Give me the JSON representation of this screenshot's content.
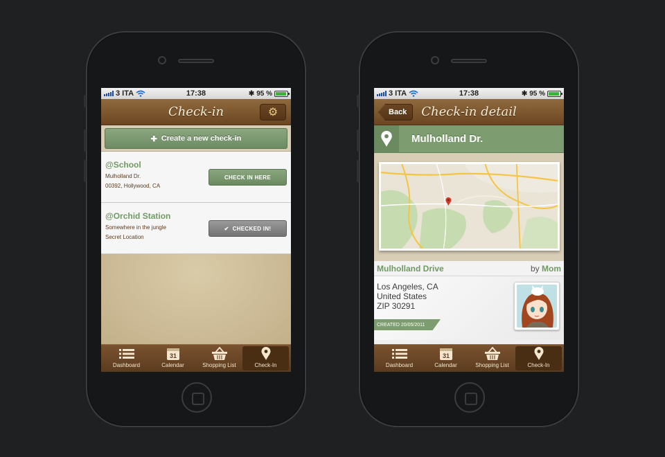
{
  "status": {
    "carrier": "3 ITA",
    "time": "17:38",
    "battery": "95 %",
    "battery_level": 0.95
  },
  "left_screen": {
    "title": "Check-in",
    "create_button": "Create a new check-in",
    "items": [
      {
        "name": "@School",
        "line1": "Mulholland Dr.",
        "line2": "00392, Hollywood, CA",
        "button": "CHECK IN HERE",
        "state": "check-in"
      },
      {
        "name": "@Orchid Station",
        "line1": "Somewhere in the jungle",
        "line2": "Secret Location",
        "button": "CHECKED IN!",
        "state": "checked"
      }
    ]
  },
  "right_screen": {
    "title": "Check-in detail",
    "back_label": "Back",
    "location_name": "Mulholland Dr.",
    "street": "Mulholland Drive",
    "by_label": "by",
    "author": "Mom",
    "address": [
      "Los Angeles, CA",
      "United States",
      "ZIP 30291"
    ],
    "created": "CREATED 20/05/2011"
  },
  "tabs": [
    {
      "label": "Dashboard",
      "icon": "list-icon"
    },
    {
      "label": "Calendar",
      "icon": "calendar-icon",
      "day": "31"
    },
    {
      "label": "Shopping List",
      "icon": "basket-icon"
    },
    {
      "label": "Check-In",
      "icon": "map-pin-icon",
      "active": true
    }
  ],
  "colors": {
    "accent_green": "#7d9c70",
    "brown": "#6b4621",
    "tan": "#d8cdb5"
  }
}
